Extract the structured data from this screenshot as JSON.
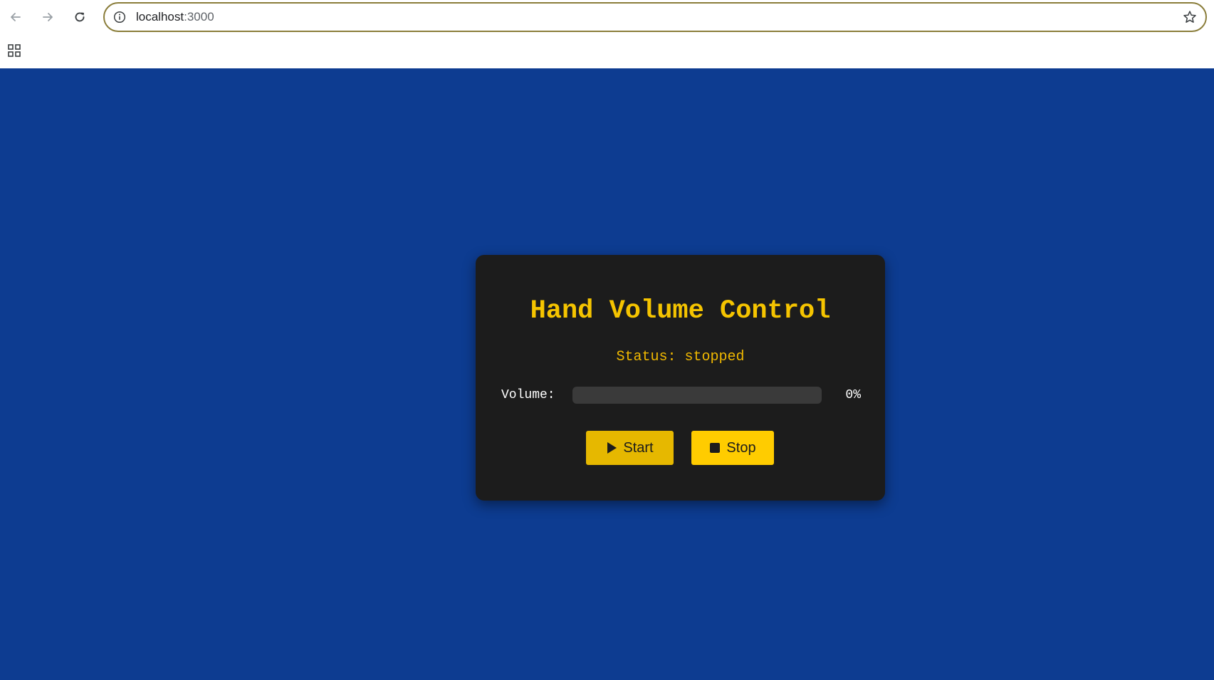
{
  "browser": {
    "url_host": "localhost",
    "url_port": ":3000",
    "icons": {
      "back": "back-arrow-icon",
      "forward": "forward-arrow-icon",
      "reload": "reload-icon",
      "site_info": "info-icon",
      "bookmark": "star-icon",
      "apps": "apps-grid-icon"
    }
  },
  "app": {
    "title": "Hand Volume Control",
    "status_label": "Status:",
    "status_value": "stopped",
    "volume_label": "Volume:",
    "volume_percent": 0,
    "volume_text": "0%",
    "start_label": "Start",
    "stop_label": "Stop"
  },
  "colors": {
    "page_background": "#0d3c91",
    "card_background": "#1c1c1c",
    "accent": "#f5c400",
    "start_button": "#e6b800",
    "stop_button": "#ffcc00"
  }
}
